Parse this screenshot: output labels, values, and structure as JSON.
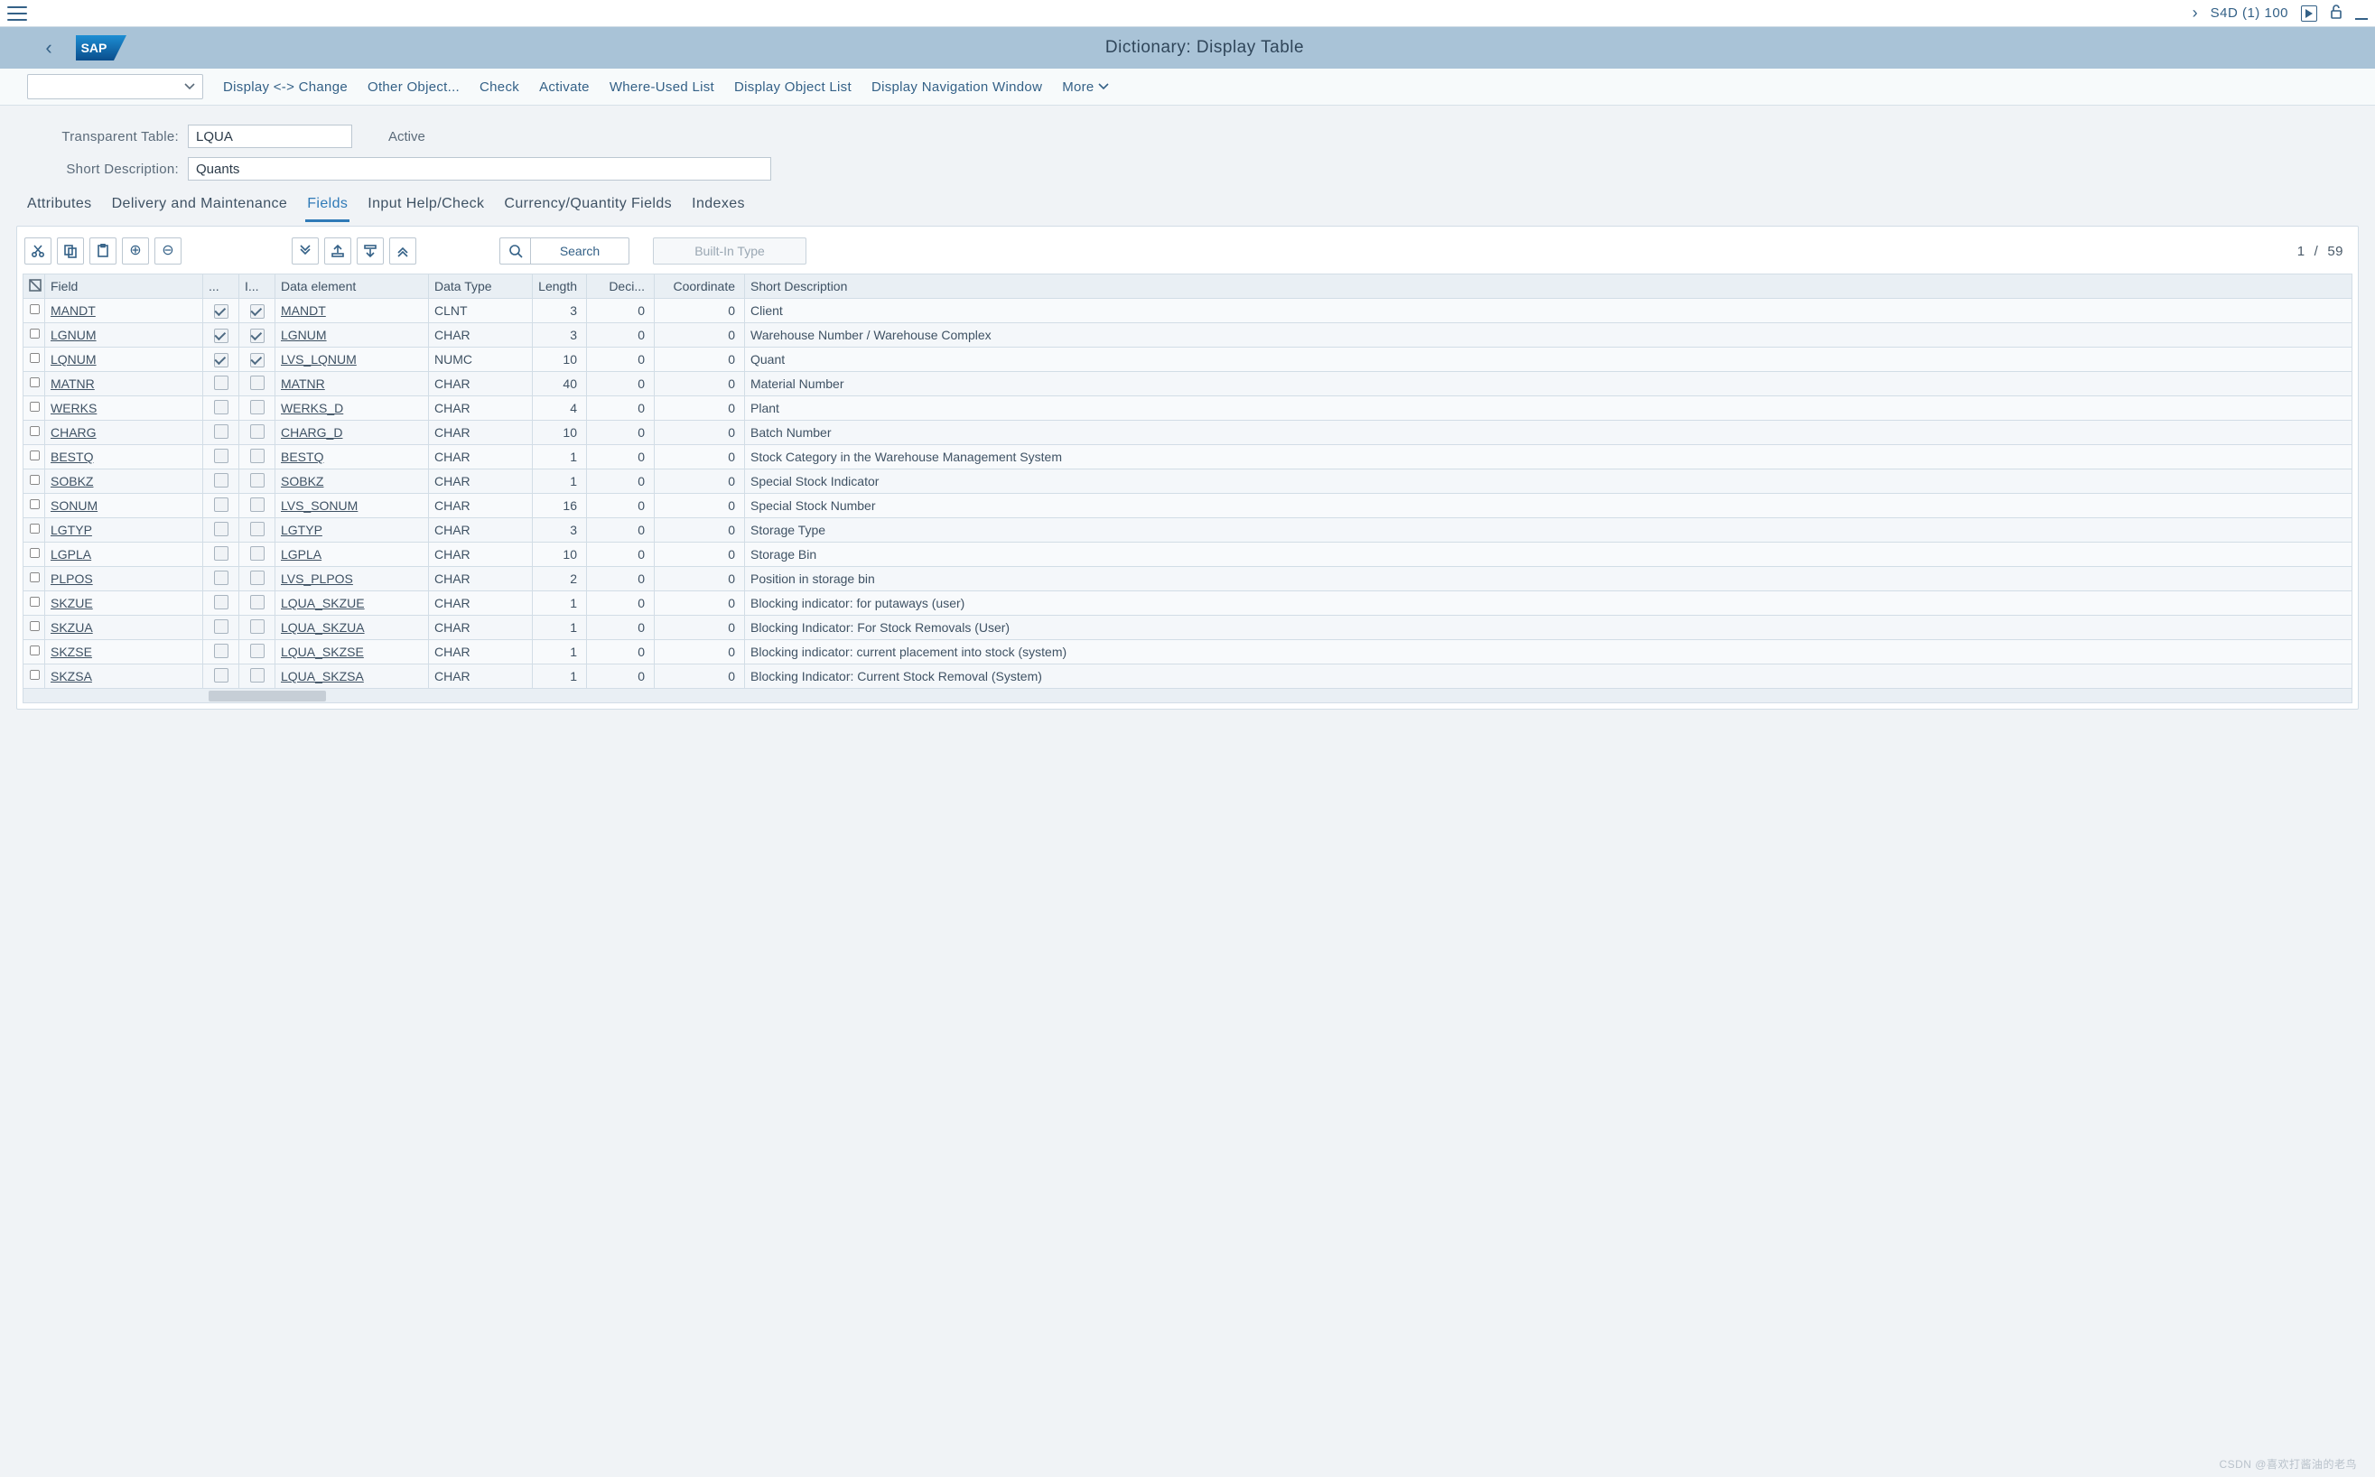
{
  "system": {
    "instance": "S4D (1) 100"
  },
  "header": {
    "title": "Dictionary: Display Table"
  },
  "toolbar": {
    "display_change": "Display <-> Change",
    "other_object": "Other Object...",
    "check": "Check",
    "activate": "Activate",
    "where_used": "Where-Used List",
    "display_object_list": "Display Object List",
    "display_nav_window": "Display Navigation Window",
    "more": "More"
  },
  "form": {
    "table_label": "Transparent Table:",
    "table_value": "LQUA",
    "status": "Active",
    "desc_label": "Short Description:",
    "desc_value": "Quants"
  },
  "tabs": {
    "attributes": "Attributes",
    "delivery": "Delivery and Maintenance",
    "fields": "Fields",
    "input_help": "Input Help/Check",
    "currency": "Currency/Quantity Fields",
    "indexes": "Indexes"
  },
  "tablebar": {
    "search": "Search",
    "builtin": "Built-In Type",
    "page_cur": "1",
    "page_sep": "/",
    "page_total": "59"
  },
  "columns": {
    "field": "Field",
    "key": "...",
    "init": "I...",
    "data_element": "Data element",
    "data_type": "Data Type",
    "length": "Length",
    "decimals": "Deci...",
    "coordinate": "Coordinate",
    "short_desc": "Short Description"
  },
  "rows": [
    {
      "field": "MANDT",
      "key": true,
      "init": true,
      "de": "MANDT",
      "dt": "CLNT",
      "len": "3",
      "dec": "0",
      "coord": "0",
      "desc": "Client"
    },
    {
      "field": "LGNUM",
      "key": true,
      "init": true,
      "de": "LGNUM",
      "dt": "CHAR",
      "len": "3",
      "dec": "0",
      "coord": "0",
      "desc": "Warehouse Number / Warehouse Complex"
    },
    {
      "field": "LQNUM",
      "key": true,
      "init": true,
      "de": "LVS_LQNUM",
      "dt": "NUMC",
      "len": "10",
      "dec": "0",
      "coord": "0",
      "desc": "Quant"
    },
    {
      "field": "MATNR",
      "key": false,
      "init": false,
      "de": "MATNR",
      "dt": "CHAR",
      "len": "40",
      "dec": "0",
      "coord": "0",
      "desc": "Material Number"
    },
    {
      "field": "WERKS",
      "key": false,
      "init": false,
      "de": "WERKS_D",
      "dt": "CHAR",
      "len": "4",
      "dec": "0",
      "coord": "0",
      "desc": "Plant"
    },
    {
      "field": "CHARG",
      "key": false,
      "init": false,
      "de": "CHARG_D",
      "dt": "CHAR",
      "len": "10",
      "dec": "0",
      "coord": "0",
      "desc": "Batch Number"
    },
    {
      "field": "BESTQ",
      "key": false,
      "init": false,
      "de": "BESTQ",
      "dt": "CHAR",
      "len": "1",
      "dec": "0",
      "coord": "0",
      "desc": "Stock Category in the Warehouse Management System"
    },
    {
      "field": "SOBKZ",
      "key": false,
      "init": false,
      "de": "SOBKZ",
      "dt": "CHAR",
      "len": "1",
      "dec": "0",
      "coord": "0",
      "desc": "Special Stock Indicator"
    },
    {
      "field": "SONUM",
      "key": false,
      "init": false,
      "de": "LVS_SONUM",
      "dt": "CHAR",
      "len": "16",
      "dec": "0",
      "coord": "0",
      "desc": "Special Stock Number"
    },
    {
      "field": "LGTYP",
      "key": false,
      "init": false,
      "de": "LGTYP",
      "dt": "CHAR",
      "len": "3",
      "dec": "0",
      "coord": "0",
      "desc": "Storage Type"
    },
    {
      "field": "LGPLA",
      "key": false,
      "init": false,
      "de": "LGPLA",
      "dt": "CHAR",
      "len": "10",
      "dec": "0",
      "coord": "0",
      "desc": "Storage Bin"
    },
    {
      "field": "PLPOS",
      "key": false,
      "init": false,
      "de": "LVS_PLPOS",
      "dt": "CHAR",
      "len": "2",
      "dec": "0",
      "coord": "0",
      "desc": "Position in storage bin"
    },
    {
      "field": "SKZUE",
      "key": false,
      "init": false,
      "de": "LQUA_SKZUE",
      "dt": "CHAR",
      "len": "1",
      "dec": "0",
      "coord": "0",
      "desc": "Blocking indicator: for putaways (user)"
    },
    {
      "field": "SKZUA",
      "key": false,
      "init": false,
      "de": "LQUA_SKZUA",
      "dt": "CHAR",
      "len": "1",
      "dec": "0",
      "coord": "0",
      "desc": "Blocking Indicator: For Stock Removals (User)"
    },
    {
      "field": "SKZSE",
      "key": false,
      "init": false,
      "de": "LQUA_SKZSE",
      "dt": "CHAR",
      "len": "1",
      "dec": "0",
      "coord": "0",
      "desc": "Blocking indicator: current placement into stock (system)"
    },
    {
      "field": "SKZSA",
      "key": false,
      "init": false,
      "de": "LQUA_SKZSA",
      "dt": "CHAR",
      "len": "1",
      "dec": "0",
      "coord": "0",
      "desc": "Blocking Indicator: Current Stock Removal (System)"
    }
  ],
  "watermark": "CSDN @喜欢打酱油的老鸟"
}
